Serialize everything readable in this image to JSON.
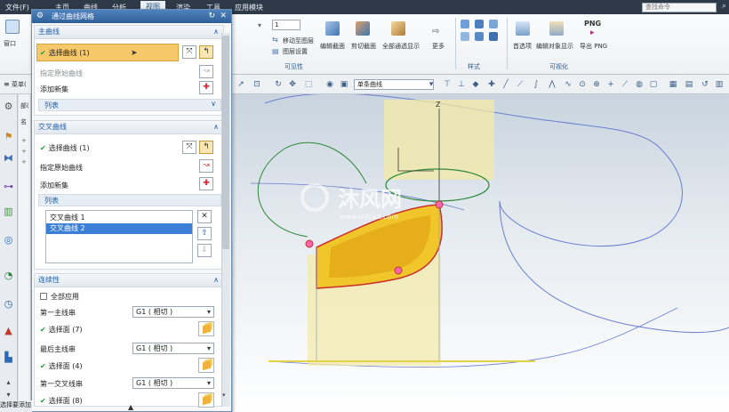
{
  "menubar": {
    "items": [
      "文件(F)",
      "主页",
      "曲线",
      "分析",
      "视图",
      "渲染",
      "工具",
      "应用模块"
    ],
    "active_index": 4,
    "search_placeholder": "查找命令"
  },
  "ribbon": {
    "window_label": "窗口",
    "layer_dropdown": "1",
    "move_layer": "移动至图层",
    "layer_settings": "图层设置",
    "edit_section": "编辑截面",
    "clip_section": "剪切截面",
    "show_all": "全部通透显示",
    "more": "更多",
    "visibility_group": "可见性",
    "style_group": "样式",
    "preferences": "首选项",
    "edit_object_display": "编辑对象显示",
    "export_png": "导出 PNG",
    "png_badge": "PNG",
    "visualization_group": "可视化"
  },
  "seltool": {
    "menu_label": "菜单(",
    "curve_rule": "单条曲线"
  },
  "dialog": {
    "title": "通过曲线网格",
    "primary": {
      "header": "主曲线",
      "select_curve": "选择曲线 (1)",
      "specify_origin": "指定原始曲线",
      "add_new_set": "添加新集",
      "list_header": "列表"
    },
    "cross": {
      "header": "交叉曲线",
      "select_curve": "选择曲线 (1)",
      "specify_origin": "指定原始曲线",
      "add_new_set": "添加新集",
      "list_header": "列表",
      "items": [
        "交叉曲线 1",
        "交叉曲线 2"
      ],
      "selected_index": 1
    },
    "continuity": {
      "header": "连续性",
      "apply_all": "全部应用",
      "first_primary": "第一主线串",
      "first_primary_value": "G1 ( 相切 )",
      "select_face_7": "选择面 (7)",
      "last_primary": "最后主线串",
      "last_primary_value": "G1 ( 相切 )",
      "select_face_4": "选择面 (4)",
      "first_cross": "第一交叉线串",
      "first_cross_value": "G1 ( 相切 )",
      "select_face_8": "选择面 (8)"
    }
  },
  "viewport": {
    "axis_z": "Z",
    "watermark_main": "沐风网",
    "watermark_url": "www.mfcad.com"
  },
  "status": {
    "text": "选择要添加"
  },
  "rail_labels": [
    "部(",
    "名"
  ]
}
